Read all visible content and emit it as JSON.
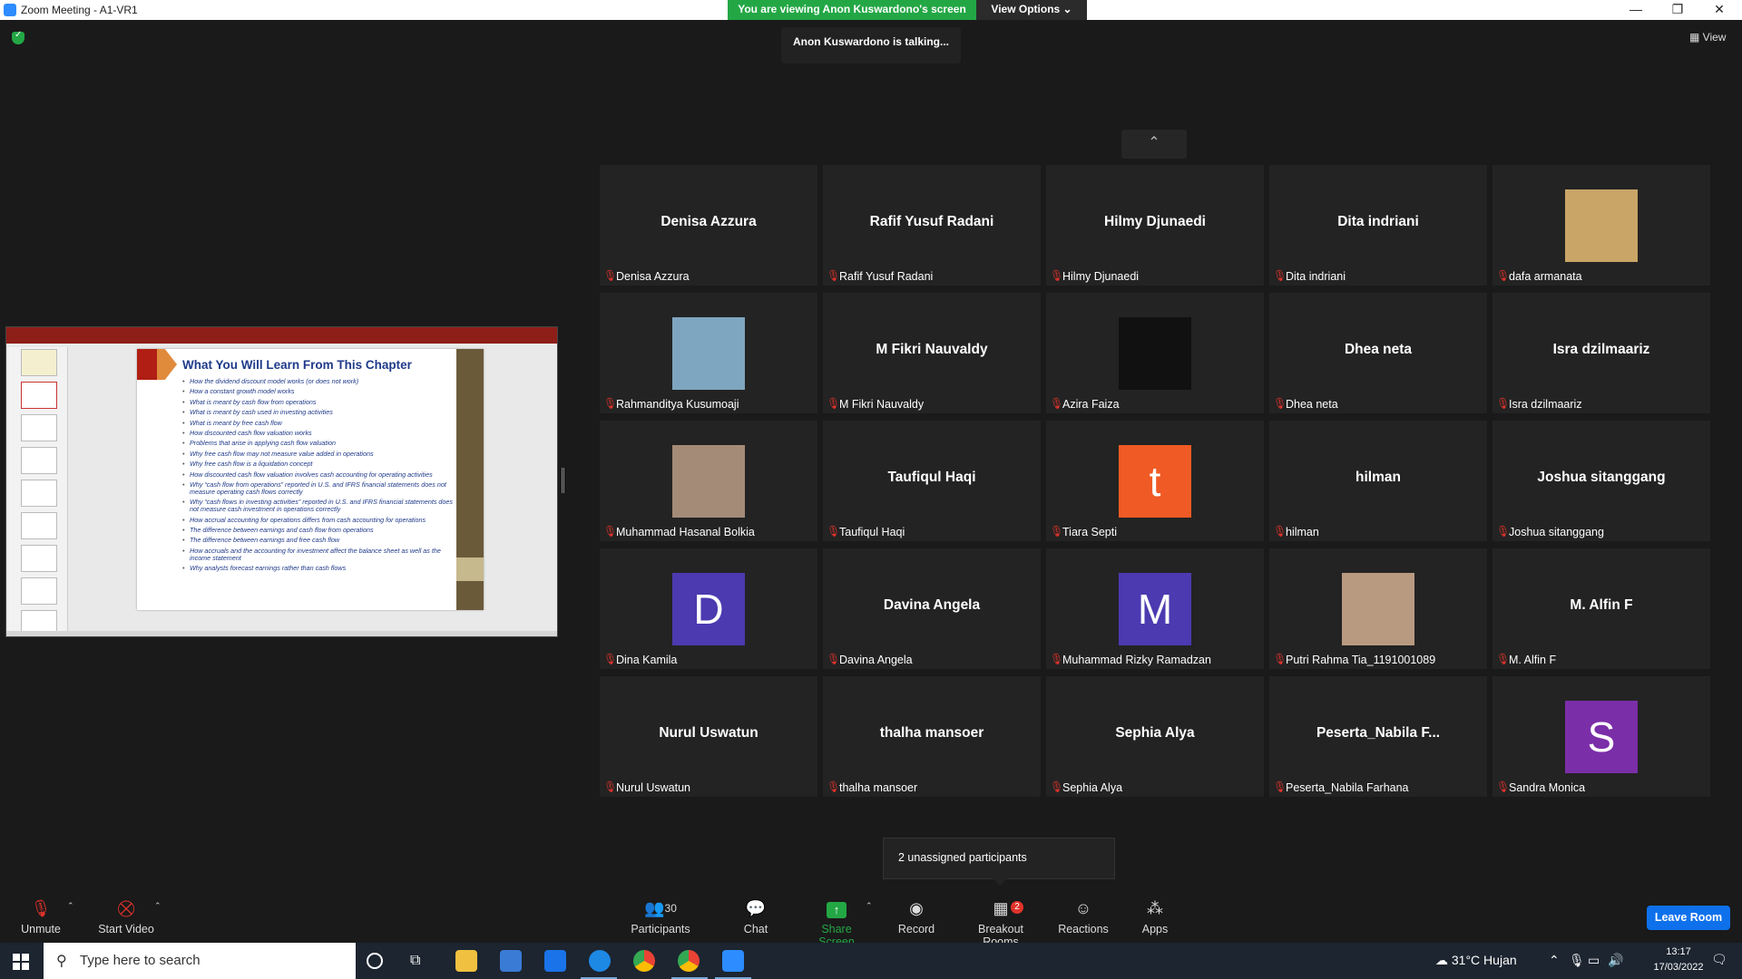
{
  "window": {
    "title": "Zoom Meeting - A1-VR1",
    "viewing_banner": "You are viewing Anon Kuswardono's screen",
    "view_options": "View Options ⌄",
    "minimize": "—",
    "maximize": "❐",
    "close": "✕"
  },
  "talking_indicator": "Anon Kuswardono is talking...",
  "view_button": "View",
  "slide": {
    "title": "What You Will Learn From This Chapter",
    "bullets": [
      "How the dividend discount model works (or does not work)",
      "How a constant growth model works",
      "What is meant by cash flow from operations",
      "What is meant by cash used in investing activities",
      "What is meant by free cash flow",
      "How discounted cash flow valuation works",
      "Problems that arise in applying cash flow valuation",
      "Why free cash flow may not measure value added in operations",
      "Why free cash flow is a liquidation concept",
      "How discounted cash flow valuation involves cash accounting for operating activities",
      "Why “cash flow from operations” reported in U.S. and IFRS financial statements does not measure operating cash flows correctly",
      "Why “cash flows in investing activities” reported in U.S. and IFRS financial statements does not measure cash investment in operations correctly",
      "How accrual accounting for operations differs from cash accounting for operations",
      "The difference between earnings and cash flow from operations",
      "The difference between earnings and free cash flow",
      "How accruals and the accounting for investment affect the balance sheet as well as the income statement",
      "Why analysts forecast earnings rather than cash flows"
    ]
  },
  "participants_grid": [
    {
      "name": "Denisa Azzura",
      "label": "Denisa Azzura",
      "kind": "name"
    },
    {
      "name": "Rafif Yusuf Radani",
      "label": "Rafif Yusuf Radani",
      "kind": "name"
    },
    {
      "name": "Hilmy Djunaedi",
      "label": "Hilmy Djunaedi",
      "kind": "name"
    },
    {
      "name": "Dita indriani",
      "label": "Dita indriani",
      "kind": "name"
    },
    {
      "name": "",
      "label": "dafa armanata",
      "kind": "photo",
      "color": "#c9a567"
    },
    {
      "name": "",
      "label": "Rahmanditya Kusumoaji",
      "kind": "photo",
      "color": "#7fa6c0"
    },
    {
      "name": "M Fikri Nauvaldy",
      "label": "M Fikri Nauvaldy",
      "kind": "name"
    },
    {
      "name": "",
      "label": "Azira Faiza",
      "kind": "photo",
      "color": "#111111"
    },
    {
      "name": "Dhea neta",
      "label": "Dhea neta",
      "kind": "name"
    },
    {
      "name": "Isra dzilmaariz",
      "label": "Isra dzilmaariz",
      "kind": "name"
    },
    {
      "name": "",
      "label": "Muhammad Hasanal Bolkia",
      "kind": "photo",
      "color": "#a48b78"
    },
    {
      "name": "Taufiqul Haqi",
      "label": "Taufiqul Haqi",
      "kind": "name"
    },
    {
      "name": "t",
      "label": "Tiara Septi",
      "kind": "avatar",
      "color": "#f05a24"
    },
    {
      "name": "hilman",
      "label": "hilman",
      "kind": "name"
    },
    {
      "name": "Joshua sitanggang",
      "label": "Joshua sitanggang",
      "kind": "name"
    },
    {
      "name": "D",
      "label": "Dina Kamila",
      "kind": "avatar",
      "color": "#4b3ab0"
    },
    {
      "name": "Davina Angela",
      "label": "Davina Angela",
      "kind": "name"
    },
    {
      "name": "M",
      "label": "Muhammad Rizky Ramadzan",
      "kind": "avatar",
      "color": "#4b3ab0"
    },
    {
      "name": "",
      "label": "Putri Rahma Tia_1191001089",
      "kind": "photo",
      "color": "#b89a80"
    },
    {
      "name": "M. Alfin F",
      "label": "M. Alfin F",
      "kind": "name"
    },
    {
      "name": "Nurul Uswatun",
      "label": "Nurul Uswatun",
      "kind": "name"
    },
    {
      "name": "thalha mansoer",
      "label": "thalha mansoer",
      "kind": "name"
    },
    {
      "name": "Sephia Alya",
      "label": "Sephia Alya",
      "kind": "name"
    },
    {
      "name": "Peserta_Nabila F...",
      "label": "Peserta_Nabila Farhana",
      "kind": "name"
    },
    {
      "name": "S",
      "label": "Sandra Monica",
      "kind": "avatar",
      "color": "#7a2ea8"
    }
  ],
  "unassigned": "2 unassigned participants",
  "toolbar": {
    "unmute": "Unmute",
    "start_video": "Start Video",
    "participants": "Participants",
    "participants_count": "30",
    "chat": "Chat",
    "share_screen": "Share Screen",
    "record": "Record",
    "breakout_rooms": "Breakout Rooms",
    "breakout_badge": "2",
    "reactions": "Reactions",
    "apps": "Apps",
    "leave": "Leave Room"
  },
  "taskbar": {
    "search_placeholder": "Type here to search",
    "weather": "31°C  Hujan",
    "time": "13:17",
    "date": "17/03/2022"
  },
  "colors": {
    "share_green": "#23a745",
    "leave_blue": "#0e71eb",
    "muted_red": "#e0332b"
  }
}
